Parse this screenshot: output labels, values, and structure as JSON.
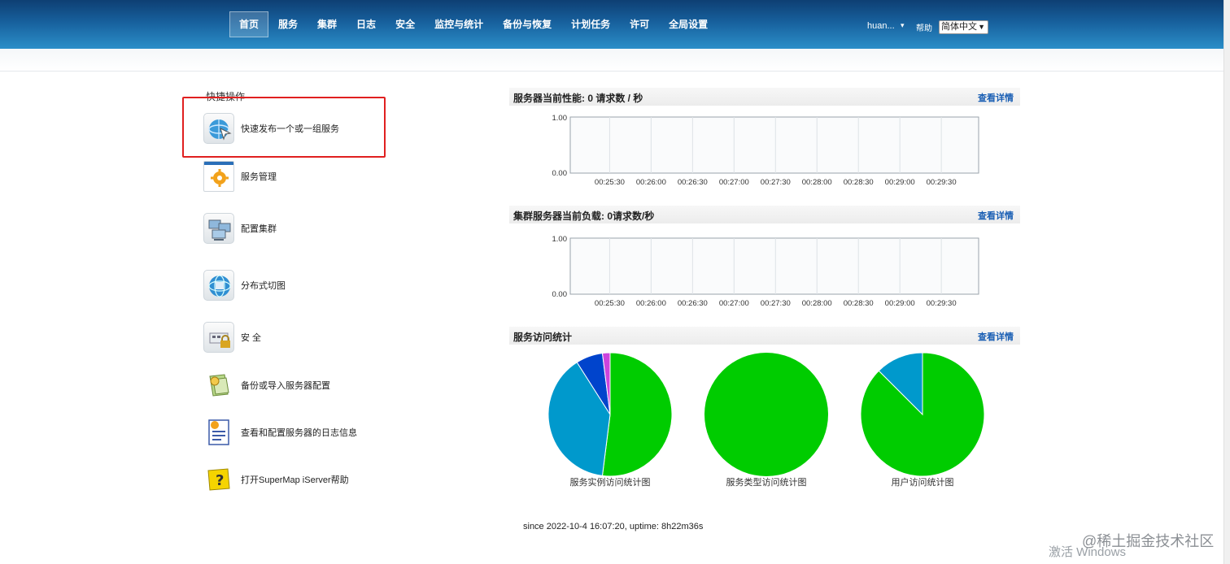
{
  "nav": {
    "items": [
      "首页",
      "服务",
      "集群",
      "日志",
      "安全",
      "监控与统计",
      "备份与恢复",
      "计划任务",
      "许可",
      "全局设置"
    ],
    "active": 0
  },
  "header": {
    "user": "huan...",
    "help": "帮助",
    "language": "简体中文"
  },
  "quick_ops": {
    "title": "快捷操作",
    "items": [
      {
        "label": "快速发布一个或一组服务",
        "icon": "globe-arrow-icon"
      },
      {
        "label": "服务管理",
        "icon": "service-gear-icon"
      },
      {
        "label": "配置集群",
        "icon": "cluster-computers-icon"
      },
      {
        "label": "分布式切图",
        "icon": "globe-grid-icon"
      },
      {
        "label": "安 全",
        "icon": "lock-icon"
      },
      {
        "label": "备份或导入服务器配置",
        "icon": "backup-icon"
      },
      {
        "label": "查看和配置服务器的日志信息",
        "icon": "log-document-icon"
      },
      {
        "label": "打开SuperMap iServer帮助",
        "icon": "help-question-icon"
      }
    ]
  },
  "panels": {
    "performance": {
      "title": "服务器当前性能:  0 请求数 / 秒",
      "link": "查看详情"
    },
    "cluster": {
      "title": "集群服务器当前负载: 0请求数/秒",
      "link": "查看详情"
    },
    "stats": {
      "title": "服务访问统计",
      "link": "查看详情"
    }
  },
  "chart_data": [
    {
      "type": "line",
      "x": [
        "00:25:30",
        "00:26:00",
        "00:26:30",
        "00:27:00",
        "00:27:30",
        "00:28:00",
        "00:28:30",
        "00:29:00",
        "00:29:30"
      ],
      "y_ticks": [
        "1.00",
        "0.00"
      ],
      "ylim": [
        0,
        1
      ],
      "series": [],
      "grid": true
    },
    {
      "type": "line",
      "x": [
        "00:25:30",
        "00:26:00",
        "00:26:30",
        "00:27:00",
        "00:27:30",
        "00:28:00",
        "00:28:30",
        "00:29:00",
        "00:29:30"
      ],
      "y_ticks": [
        "1.00",
        "0.00"
      ],
      "ylim": [
        0,
        1
      ],
      "series": [],
      "grid": true
    },
    {
      "type": "pie",
      "caption": "服务实例访问统计图",
      "values": [
        0.52,
        0.39,
        0.07,
        0.02
      ],
      "colors": [
        "#00cc00",
        "#0099cc",
        "#0044cc",
        "#cc44dd"
      ]
    },
    {
      "type": "pie",
      "caption": "服务类型访问统计图",
      "values": [
        1.0
      ],
      "colors": [
        "#00cc00"
      ]
    },
    {
      "type": "pie",
      "caption": "用户访问统计图",
      "values": [
        0.875,
        0.125
      ],
      "colors": [
        "#00cc00",
        "#0099cc"
      ]
    }
  ],
  "footer": "since 2022-10-4 16:07:20, uptime: 8h22m36s",
  "watermark": {
    "left": "激活 Windows",
    "right": "@稀土掘金技术社区"
  },
  "colors": {
    "header_top": "#0e3f73",
    "header_bottom": "#2b8ec8",
    "link": "#1a5fb4",
    "highlight": "#e02020"
  }
}
